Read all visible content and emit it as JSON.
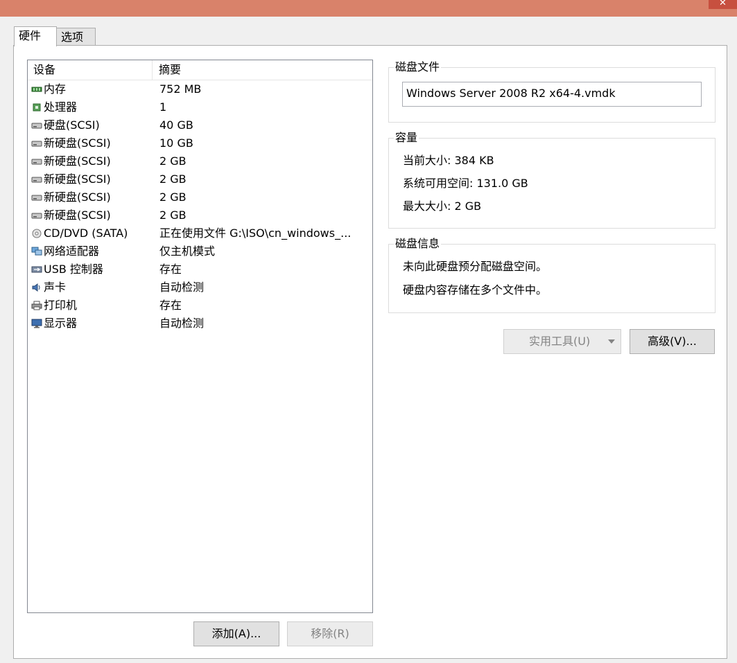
{
  "tabs": [
    {
      "label": "硬件",
      "active": true
    },
    {
      "label": "选项",
      "active": false
    }
  ],
  "device_list": {
    "headers": {
      "device": "设备",
      "summary": "摘要"
    },
    "rows": [
      {
        "icon": "memory-icon",
        "name": "内存",
        "summary": "752 MB"
      },
      {
        "icon": "processor-icon",
        "name": "处理器",
        "summary": "1"
      },
      {
        "icon": "hard-disk-icon",
        "name": "硬盘(SCSI)",
        "summary": "40 GB"
      },
      {
        "icon": "hard-disk-icon",
        "name": "新硬盘(SCSI)",
        "summary": "10 GB"
      },
      {
        "icon": "hard-disk-icon",
        "name": "新硬盘(SCSI)",
        "summary": "2 GB"
      },
      {
        "icon": "hard-disk-icon",
        "name": "新硬盘(SCSI)",
        "summary": "2 GB"
      },
      {
        "icon": "hard-disk-icon",
        "name": "新硬盘(SCSI)",
        "summary": "2 GB"
      },
      {
        "icon": "hard-disk-icon",
        "name": "新硬盘(SCSI)",
        "summary": "2 GB"
      },
      {
        "icon": "cd-dvd-icon",
        "name": "CD/DVD (SATA)",
        "summary": "正在使用文件 G:\\ISO\\cn_windows_..."
      },
      {
        "icon": "network-adapter-icon",
        "name": "网络适配器",
        "summary": "仅主机模式"
      },
      {
        "icon": "usb-icon",
        "name": "USB 控制器",
        "summary": "存在"
      },
      {
        "icon": "sound-card-icon",
        "name": "声卡",
        "summary": "自动检测"
      },
      {
        "icon": "printer-icon",
        "name": "打印机",
        "summary": "存在"
      },
      {
        "icon": "display-icon",
        "name": "显示器",
        "summary": "自动检测"
      }
    ]
  },
  "buttons": {
    "add": "添加(A)...",
    "remove": "移除(R)",
    "utilities": "实用工具(U)",
    "advanced": "高级(V)..."
  },
  "disk_file": {
    "title": "磁盘文件",
    "value": "Windows Server 2008 R2 x64-4.vmdk"
  },
  "capacity": {
    "title": "容量",
    "current_size": "当前大小: 384 KB",
    "available_space": "系统可用空间: 131.0 GB",
    "max_size": "最大大小: 2 GB"
  },
  "disk_info": {
    "title": "磁盘信息",
    "line1": "未向此硬盘预分配磁盘空间。",
    "line2": "硬盘内容存储在多个文件中。"
  },
  "window": {
    "close_glyph": "✕"
  }
}
